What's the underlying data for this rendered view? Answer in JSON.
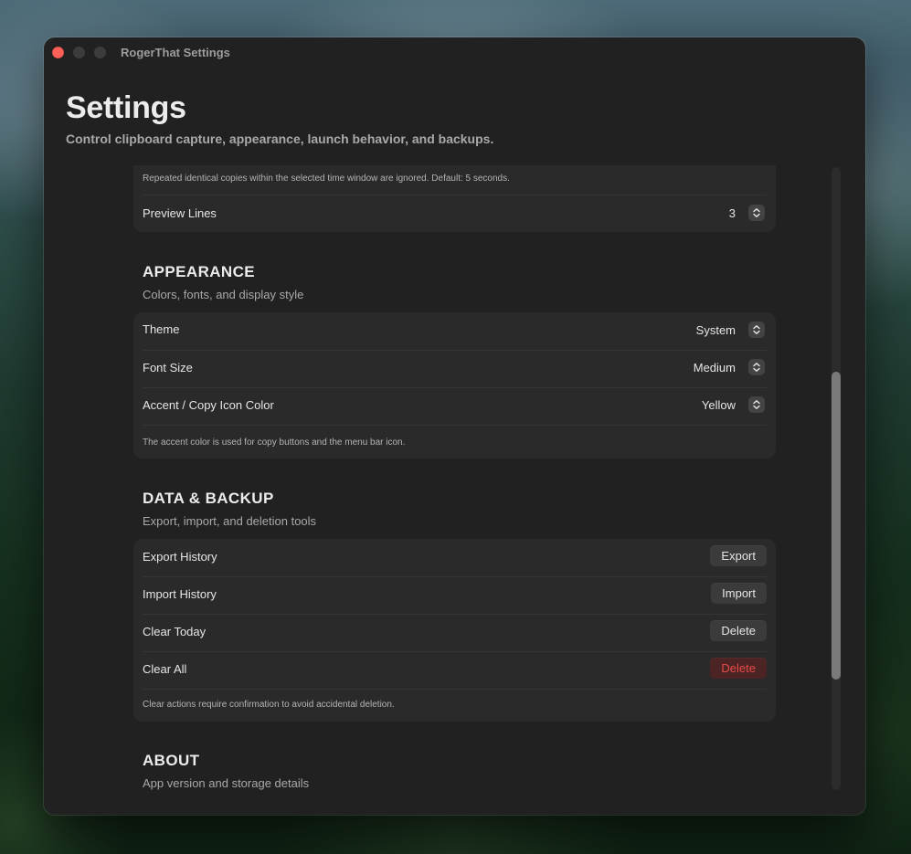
{
  "window": {
    "title": "RogerThat Settings"
  },
  "header": {
    "title": "Settings",
    "subtitle": "Control clipboard capture, appearance, launch behavior, and backups."
  },
  "capture": {
    "note": "Repeated identical copies within the selected time window are ignored. Default: 5 seconds.",
    "preview_lines": {
      "label": "Preview Lines",
      "value": "3"
    }
  },
  "appearance": {
    "title": "APPEARANCE",
    "subtitle": "Colors, fonts, and display style",
    "theme": {
      "label": "Theme",
      "value": "System"
    },
    "font_size": {
      "label": "Font Size",
      "value": "Medium"
    },
    "accent": {
      "label": "Accent / Copy Icon Color",
      "value": "Yellow"
    },
    "note": "The accent color is used for copy buttons and the menu bar icon."
  },
  "data_backup": {
    "title": "DATA & BACKUP",
    "subtitle": "Export, import, and deletion tools",
    "export": {
      "label": "Export History",
      "button": "Export"
    },
    "import": {
      "label": "Import History",
      "button": "Import"
    },
    "clear_today": {
      "label": "Clear Today",
      "button": "Delete"
    },
    "clear_all": {
      "label": "Clear All",
      "button": "Delete"
    },
    "note": "Clear actions require confirmation to avoid accidental deletion."
  },
  "about": {
    "title": "ABOUT",
    "subtitle": "App version and storage details"
  },
  "colors": {
    "window_bg": "#212121",
    "card_bg": "#2a2a2a",
    "close_button": "#fe5f57",
    "danger_text": "#e84a4a",
    "danger_bg": "#4d2424"
  },
  "icons": [
    "close-icon",
    "minimize-icon",
    "zoom-icon",
    "stepper-chevrons-icon"
  ]
}
